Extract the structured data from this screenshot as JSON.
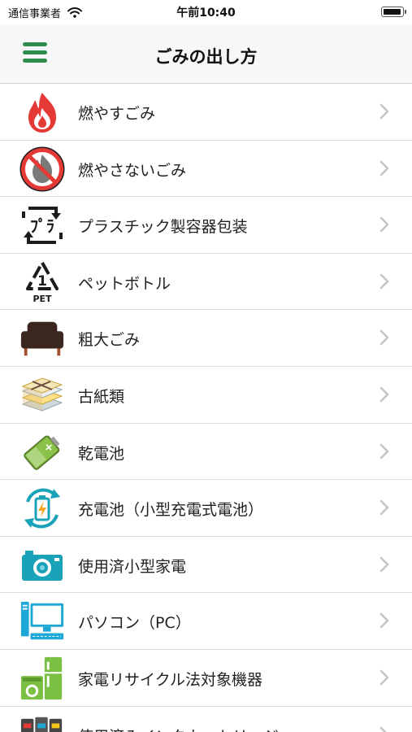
{
  "status_bar": {
    "carrier": "通信事業者",
    "time": "午前10:40"
  },
  "nav": {
    "title": "ごみの出し方"
  },
  "items": [
    {
      "label": "燃やすごみ",
      "icon": "flame-icon"
    },
    {
      "label": "燃やさないごみ",
      "icon": "no-burn-icon"
    },
    {
      "label": "プラスチック製容器包装",
      "icon": "plastic-recycle-icon"
    },
    {
      "label": "ペットボトル",
      "icon": "pet-recycle-icon",
      "icon_text": "PET",
      "icon_number": "1"
    },
    {
      "label": "粗大ごみ",
      "icon": "sofa-icon"
    },
    {
      "label": "古紙類",
      "icon": "newspaper-stack-icon"
    },
    {
      "label": "乾電池",
      "icon": "battery-icon"
    },
    {
      "label": "充電池（小型充電式電池）",
      "icon": "rechargeable-battery-icon"
    },
    {
      "label": "使用済小型家電",
      "icon": "camera-icon"
    },
    {
      "label": "パソコン（PC）",
      "icon": "computer-icon"
    },
    {
      "label": "家電リサイクル法対象機器",
      "icon": "appliance-icon"
    },
    {
      "label": "使用済みインクカートリッジ",
      "icon": "ink-cartridge-icon"
    }
  ],
  "colors": {
    "accent": "#2e8c4d",
    "flame": "#e53935",
    "camera": "#1aa3b8",
    "computer": "#1da7d6",
    "appliance": "#7bc043",
    "sofa": "#3b2620",
    "chevron": "#c4c4c4"
  }
}
